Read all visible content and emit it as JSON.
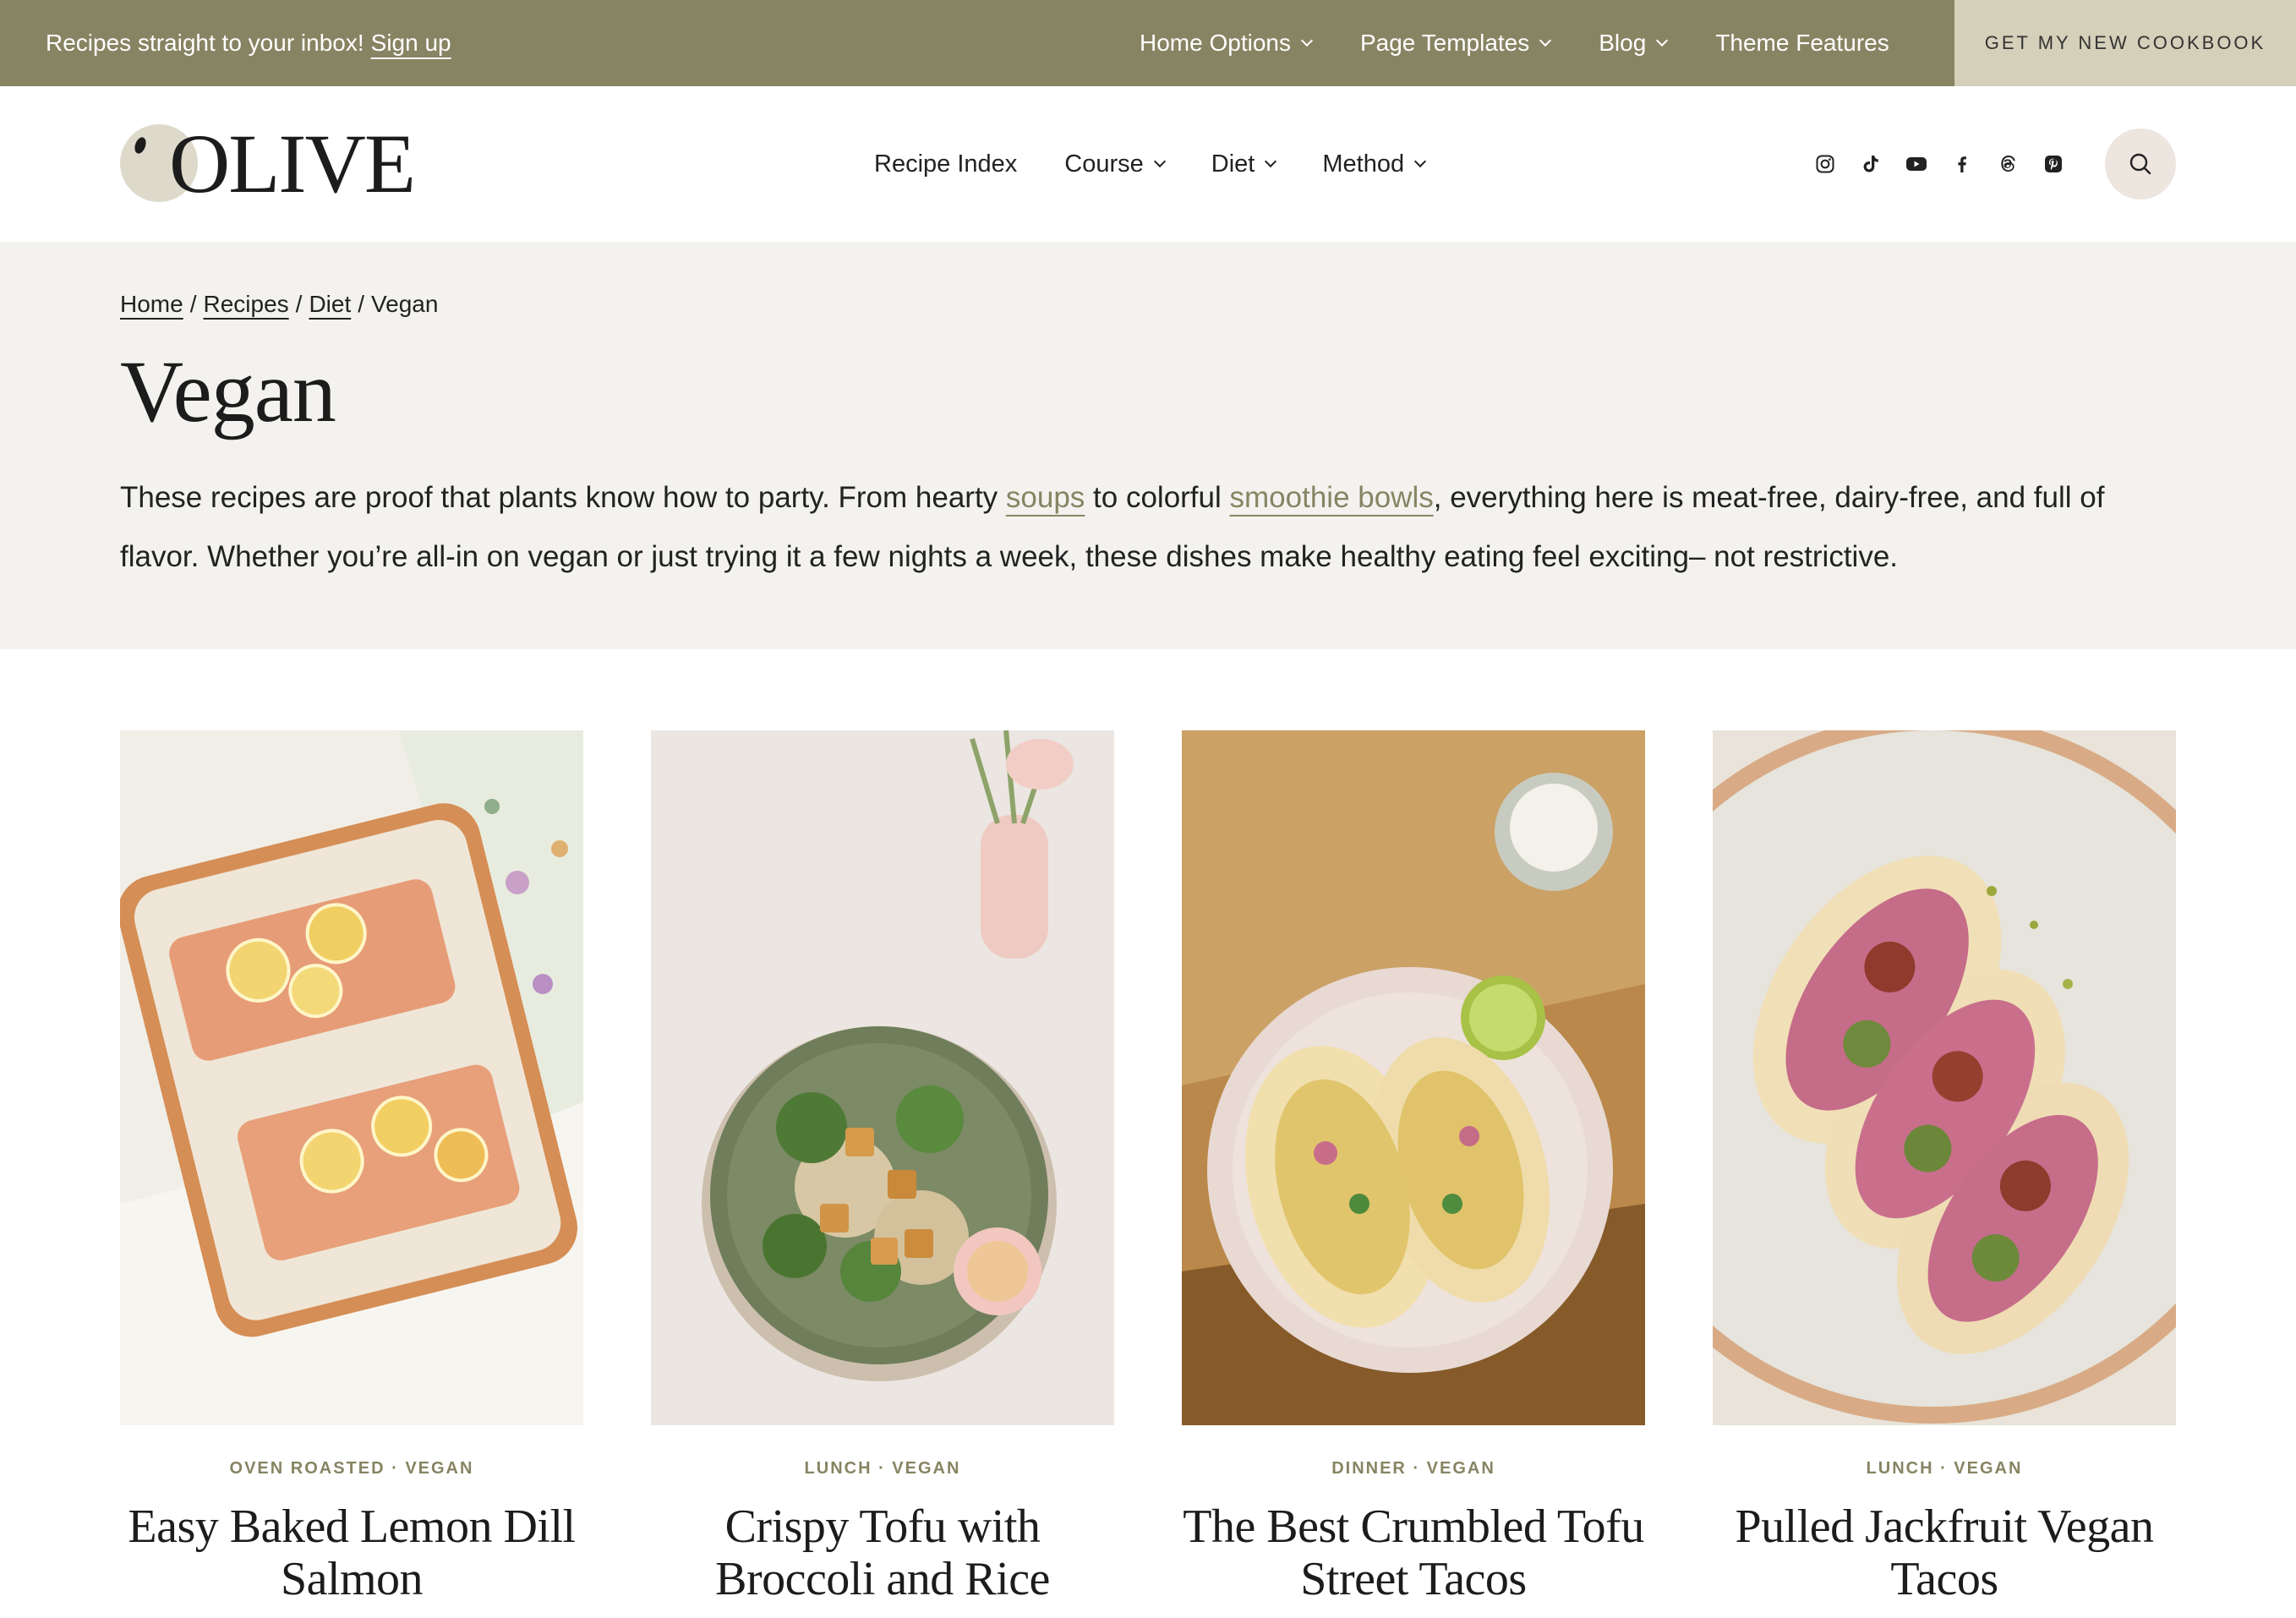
{
  "topbar": {
    "promo_text": "Recipes straight to your inbox!",
    "promo_link": "Sign up",
    "nav": [
      {
        "label": "Home Options"
      },
      {
        "label": "Page Templates"
      },
      {
        "label": "Blog"
      },
      {
        "label": "Theme Features"
      }
    ],
    "cookbook_button": "GET MY NEW COOKBOOK"
  },
  "header": {
    "logo_text": "OLIVE",
    "nav": [
      {
        "label": "Recipe Index"
      },
      {
        "label": "Course"
      },
      {
        "label": "Diet"
      },
      {
        "label": "Method"
      }
    ],
    "social_icons": [
      "instagram-icon",
      "tiktok-icon",
      "youtube-icon",
      "facebook-icon",
      "threads-icon",
      "pinterest-icon"
    ]
  },
  "hero": {
    "breadcrumb": [
      "Home",
      "Recipes",
      "Diet",
      "Vegan"
    ],
    "breadcrumb_sep": "/",
    "title": "Vegan",
    "intro_part1": "These recipes are proof that plants know how to party. From hearty ",
    "intro_link1": "soups",
    "intro_part2": " to colorful ",
    "intro_link2": "smoothie bowls",
    "intro_part3": ", everything here is meat-free, dairy-free, and full of flavor. Whether you’re all-in on vegan or just trying it a few nights a week, these dishes make healthy eating feel exciting– not restrictive."
  },
  "cards": [
    {
      "category": "OVEN ROASTED · VEGAN",
      "title": "Easy Baked Lemon Dill Salmon"
    },
    {
      "category": "LUNCH · VEGAN",
      "title": "Crispy Tofu with Broccoli and Rice"
    },
    {
      "category": "DINNER · VEGAN",
      "title": "The Best Crumbled Tofu Street Tacos"
    },
    {
      "category": "LUNCH · VEGAN",
      "title": "Pulled Jackfruit Vegan Tacos"
    }
  ],
  "colors": {
    "accent": "#878463",
    "cookbook_bg": "#d4d0b9",
    "hero_bg": "#f3f2ef"
  }
}
